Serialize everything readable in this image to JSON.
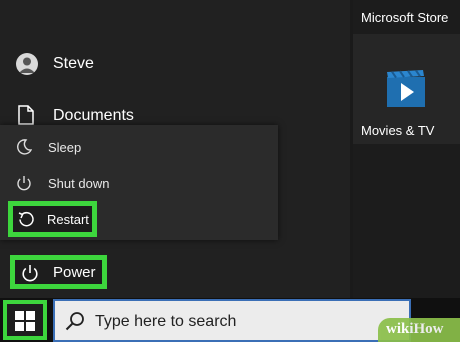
{
  "start_menu": {
    "user": {
      "label": "Steve",
      "icon": "user-avatar-icon"
    },
    "documents": {
      "label": "Documents",
      "icon": "document-icon"
    },
    "power_flyout": {
      "items": [
        {
          "label": "Sleep",
          "icon": "moon-icon"
        },
        {
          "label": "Shut down",
          "icon": "power-icon"
        },
        {
          "label": "Restart",
          "icon": "restart-icon",
          "highlighted": true
        }
      ]
    },
    "power_button": {
      "label": "Power",
      "icon": "power-icon",
      "highlighted": true
    },
    "tiles": [
      {
        "label": "Microsoft Store"
      },
      {
        "label": "Movies & TV",
        "icon": "movies-tv-icon"
      }
    ]
  },
  "taskbar": {
    "start_button": {
      "icon": "windows-logo-icon",
      "highlighted": true
    },
    "search": {
      "placeholder": "Type here to search",
      "icon": "search-icon"
    }
  },
  "watermark": {
    "text": "wikiHow"
  },
  "colors": {
    "highlight": "#3dd63d",
    "search_border": "#3b6fb6",
    "movies_tile": "#1f6fb0"
  }
}
